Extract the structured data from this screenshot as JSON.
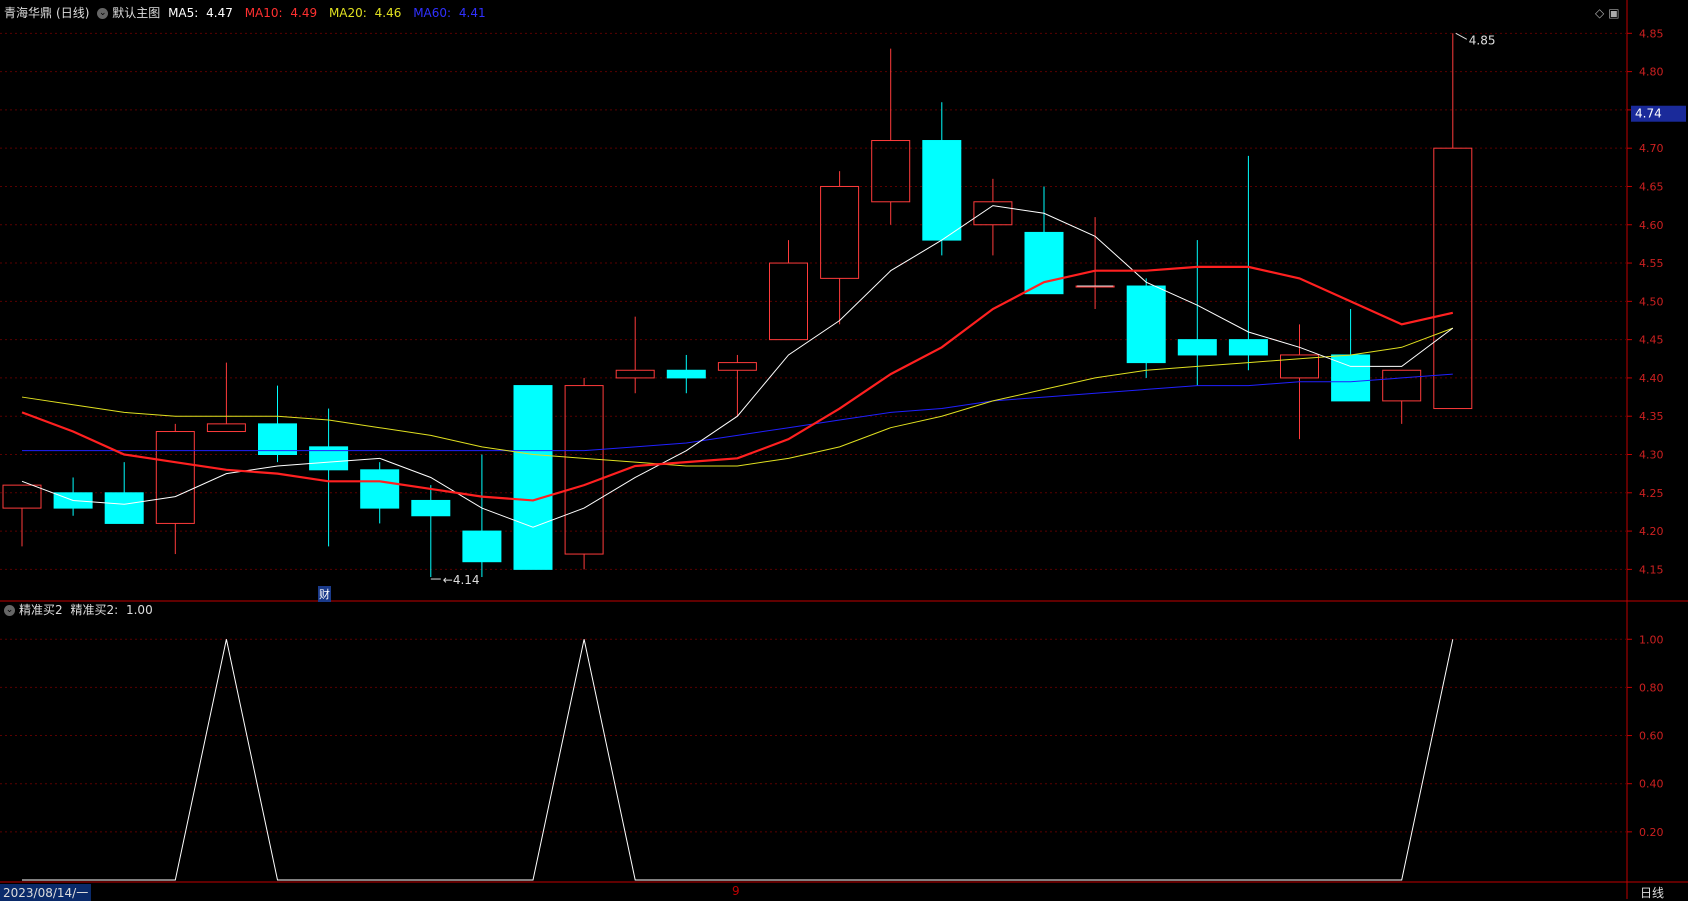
{
  "header": {
    "stock_name": "青海华鼎",
    "period": "(日线)",
    "main_chart_label": "默认主图",
    "ma5_label": "MA5:",
    "ma5_value": "4.47",
    "ma10_label": "MA10:",
    "ma10_value": "4.49",
    "ma20_label": "MA20:",
    "ma20_value": "4.46",
    "ma60_label": "MA60:",
    "ma60_value": "4.41"
  },
  "indicator": {
    "name": "精准买2",
    "label": "精准买2:",
    "value": "1.00"
  },
  "footer": {
    "date": "2023/08/14/一",
    "period_button": "日线",
    "mid_marker": "9"
  },
  "annotations": {
    "high_label": "4.85",
    "low_label": "4.14",
    "current_price": "4.74",
    "finance_badge": "财"
  },
  "colors": {
    "up": "#ff3b3b",
    "down": "#00ffff",
    "ma5": "#ffffff",
    "ma10": "#ff2020",
    "ma20": "#e0e020",
    "ma60": "#2020ff",
    "axis": "#c00000",
    "grid": "#5a0000"
  },
  "chart_data": [
    {
      "type": "candlestick",
      "ylim": [
        4.11,
        4.87
      ],
      "y_ticks": [
        4.15,
        4.2,
        4.25,
        4.3,
        4.35,
        4.4,
        4.45,
        4.5,
        4.55,
        4.6,
        4.65,
        4.7,
        4.75,
        4.8,
        4.85
      ],
      "candles": [
        {
          "o": 4.23,
          "h": 4.26,
          "l": 4.18,
          "c": 4.26
        },
        {
          "o": 4.25,
          "h": 4.27,
          "l": 4.22,
          "c": 4.23
        },
        {
          "o": 4.25,
          "h": 4.29,
          "l": 4.21,
          "c": 4.21
        },
        {
          "o": 4.21,
          "h": 4.34,
          "l": 4.17,
          "c": 4.33
        },
        {
          "o": 4.33,
          "h": 4.42,
          "l": 4.33,
          "c": 4.34
        },
        {
          "o": 4.34,
          "h": 4.39,
          "l": 4.29,
          "c": 4.3
        },
        {
          "o": 4.31,
          "h": 4.36,
          "l": 4.18,
          "c": 4.28
        },
        {
          "o": 4.28,
          "h": 4.29,
          "l": 4.21,
          "c": 4.23
        },
        {
          "o": 4.24,
          "h": 4.26,
          "l": 4.14,
          "c": 4.22
        },
        {
          "o": 4.2,
          "h": 4.3,
          "l": 4.14,
          "c": 4.16
        },
        {
          "o": 4.39,
          "h": 4.39,
          "l": 4.15,
          "c": 4.15
        },
        {
          "o": 4.17,
          "h": 4.4,
          "l": 4.15,
          "c": 4.39
        },
        {
          "o": 4.4,
          "h": 4.48,
          "l": 4.38,
          "c": 4.41
        },
        {
          "o": 4.41,
          "h": 4.43,
          "l": 4.38,
          "c": 4.4
        },
        {
          "o": 4.41,
          "h": 4.43,
          "l": 4.35,
          "c": 4.42
        },
        {
          "o": 4.45,
          "h": 4.58,
          "l": 4.45,
          "c": 4.55
        },
        {
          "o": 4.53,
          "h": 4.67,
          "l": 4.47,
          "c": 4.65
        },
        {
          "o": 4.63,
          "h": 4.83,
          "l": 4.6,
          "c": 4.71
        },
        {
          "o": 4.71,
          "h": 4.76,
          "l": 4.56,
          "c": 4.58
        },
        {
          "o": 4.6,
          "h": 4.66,
          "l": 4.56,
          "c": 4.63
        },
        {
          "o": 4.59,
          "h": 4.65,
          "l": 4.51,
          "c": 4.51
        },
        {
          "o": 4.52,
          "h": 4.61,
          "l": 4.49,
          "c": 4.52
        },
        {
          "o": 4.52,
          "h": 4.53,
          "l": 4.4,
          "c": 4.42
        },
        {
          "o": 4.45,
          "h": 4.58,
          "l": 4.39,
          "c": 4.43
        },
        {
          "o": 4.45,
          "h": 4.69,
          "l": 4.41,
          "c": 4.43
        },
        {
          "o": 4.4,
          "h": 4.47,
          "l": 4.32,
          "c": 4.43
        },
        {
          "o": 4.43,
          "h": 4.49,
          "l": 4.37,
          "c": 4.37
        },
        {
          "o": 4.37,
          "h": 4.41,
          "l": 4.34,
          "c": 4.41
        },
        {
          "o": 4.36,
          "h": 4.85,
          "l": 4.36,
          "c": 4.7
        }
      ],
      "ma5": [
        4.265,
        4.24,
        4.235,
        4.245,
        4.275,
        4.285,
        4.29,
        4.295,
        4.27,
        4.23,
        4.205,
        4.23,
        4.27,
        4.305,
        4.35,
        4.43,
        4.475,
        4.54,
        4.58,
        4.625,
        4.615,
        4.585,
        4.525,
        4.495,
        4.46,
        4.44,
        4.415,
        4.415,
        4.465
      ],
      "ma10": [
        4.355,
        4.33,
        4.3,
        4.29,
        4.28,
        4.275,
        4.265,
        4.265,
        4.255,
        4.245,
        4.24,
        4.26,
        4.285,
        4.29,
        4.295,
        4.32,
        4.36,
        4.405,
        4.44,
        4.49,
        4.525,
        4.54,
        4.54,
        4.545,
        4.545,
        4.53,
        4.5,
        4.47,
        4.485
      ],
      "ma20": [
        4.375,
        4.365,
        4.355,
        4.35,
        4.35,
        4.35,
        4.345,
        4.335,
        4.325,
        4.31,
        4.3,
        4.295,
        4.29,
        4.285,
        4.285,
        4.295,
        4.31,
        4.335,
        4.35,
        4.37,
        4.385,
        4.4,
        4.41,
        4.415,
        4.42,
        4.425,
        4.43,
        4.44,
        4.465
      ],
      "ma60": [
        4.305,
        4.305,
        4.305,
        4.305,
        4.305,
        4.305,
        4.305,
        4.305,
        4.305,
        4.305,
        4.305,
        4.305,
        4.31,
        4.315,
        4.325,
        4.335,
        4.345,
        4.355,
        4.36,
        4.37,
        4.375,
        4.38,
        4.385,
        4.39,
        4.39,
        4.395,
        4.395,
        4.4,
        4.405
      ]
    },
    {
      "type": "line",
      "name": "精准买2",
      "ylim": [
        0,
        1.08
      ],
      "y_ticks": [
        0.2,
        0.4,
        0.6,
        0.8,
        1.0
      ],
      "values": [
        0,
        0,
        0,
        0,
        1,
        0,
        0,
        0,
        0,
        0,
        0,
        1,
        0,
        0,
        0,
        0,
        0,
        0,
        0,
        0,
        0,
        0,
        0,
        0,
        0,
        0,
        0,
        0,
        1
      ]
    }
  ]
}
